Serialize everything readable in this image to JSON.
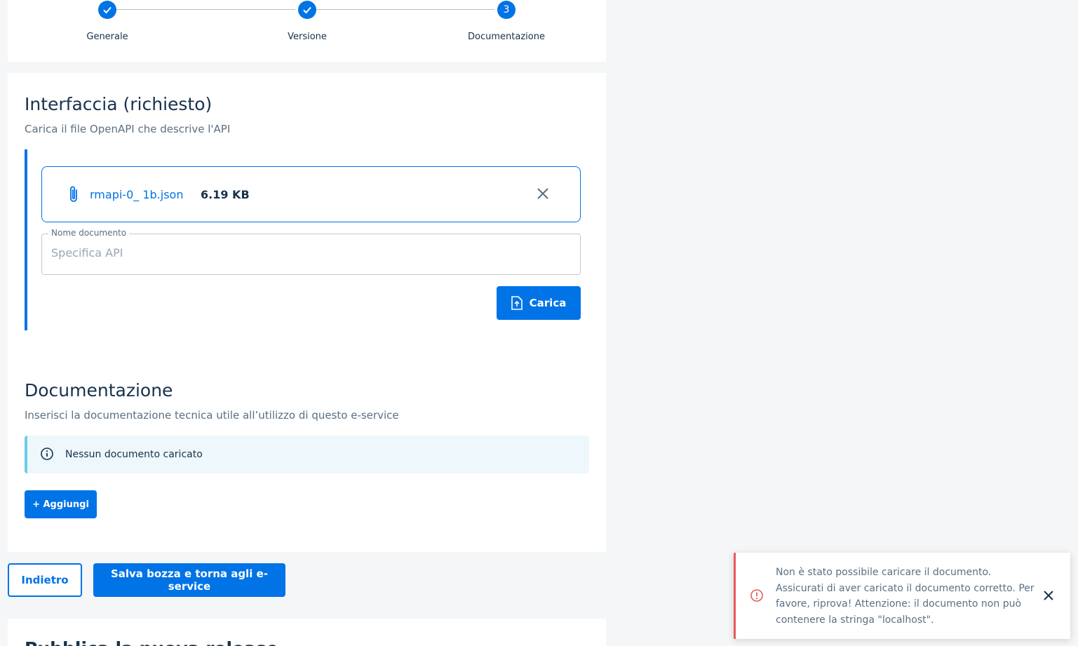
{
  "stepper": {
    "steps": [
      {
        "label": "Generale",
        "state": "done"
      },
      {
        "label": "Versione",
        "state": "done"
      },
      {
        "label": "Documentazione",
        "state": "current",
        "number": "3"
      }
    ]
  },
  "interface_section": {
    "title": "Interfaccia (richiesto)",
    "subtitle": "Carica il file OpenAPI che descrive l'API",
    "file": {
      "name": "rmapi-0_ 1b.json",
      "size": "6.19 KB",
      "icon": "paperclip-icon"
    },
    "document_name_field": {
      "label": "Nome documento",
      "placeholder": "Specifica API"
    },
    "upload_button": "Carica"
  },
  "documentation_section": {
    "title": "Documentazione",
    "subtitle": "Inserisci la documentazione tecnica utile all’utilizzo di questo e-service",
    "info": "Nessun documento caricato",
    "add_button": "+ Aggiungi"
  },
  "actions": {
    "back": "Indietro",
    "save": "Salva bozza e torna agli e-service"
  },
  "bottom_section": {
    "title": "Pubblica la nuova release"
  },
  "toast": {
    "message": "Non è stato possibile caricare il documento. Assicurati di aver caricato il documento corretto. Per favore, riprova! Attenzione: il documento non può contenere la stringa \"localhost\".",
    "type": "error"
  },
  "colors": {
    "primary": "#0073e6",
    "error": "#e8595a",
    "info": "#6bcde8",
    "text": "#17324d"
  }
}
